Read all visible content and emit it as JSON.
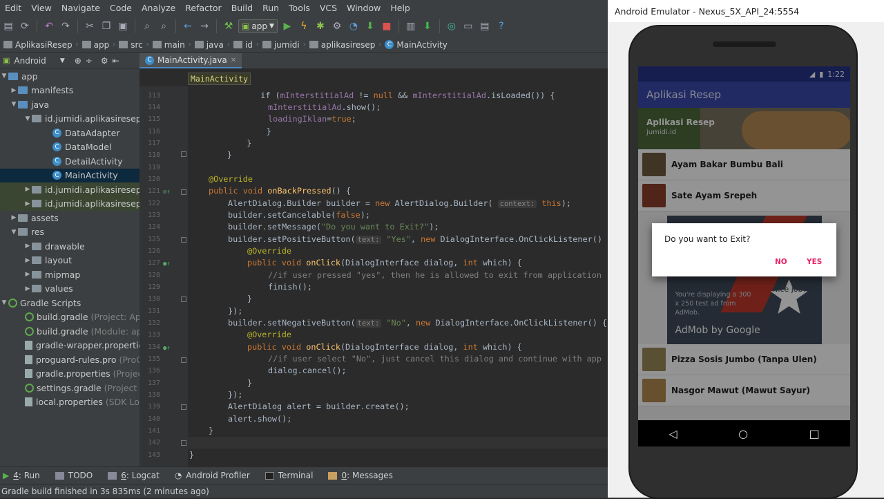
{
  "menu": [
    "Edit",
    "View",
    "Navigate",
    "Code",
    "Analyze",
    "Refactor",
    "Build",
    "Run",
    "Tools",
    "VCS",
    "Window",
    "Help"
  ],
  "toolbar": {
    "run_config": "app"
  },
  "breadcrumbs": [
    "AplikasiResep",
    "app",
    "src",
    "main",
    "java",
    "id",
    "jumidi",
    "aplikasiresep",
    "MainActivity"
  ],
  "project": {
    "view_mode": "Android",
    "tree": [
      {
        "label": "app",
        "hint": ""
      },
      {
        "label": "manifests",
        "hint": ""
      },
      {
        "label": "java",
        "hint": ""
      },
      {
        "label": "id.jumidi.aplikasiresep",
        "hint": ""
      },
      {
        "label": "DataAdapter",
        "hint": ""
      },
      {
        "label": "DataModel",
        "hint": ""
      },
      {
        "label": "DetailActivity",
        "hint": ""
      },
      {
        "label": "MainActivity",
        "hint": ""
      },
      {
        "label": "id.jumidi.aplikasiresep",
        "hint": "("
      },
      {
        "label": "id.jumidi.aplikasiresep",
        "hint": "("
      },
      {
        "label": "assets",
        "hint": ""
      },
      {
        "label": "res",
        "hint": ""
      },
      {
        "label": "drawable",
        "hint": ""
      },
      {
        "label": "layout",
        "hint": ""
      },
      {
        "label": "mipmap",
        "hint": ""
      },
      {
        "label": "values",
        "hint": ""
      },
      {
        "label": "Gradle Scripts",
        "hint": ""
      },
      {
        "label": "build.gradle",
        "hint": "(Project: Aplika"
      },
      {
        "label": "build.gradle",
        "hint": "(Module: app)"
      },
      {
        "label": "gradle-wrapper.properties",
        "hint": "("
      },
      {
        "label": "proguard-rules.pro",
        "hint": "(ProGua"
      },
      {
        "label": "gradle.properties",
        "hint": "(Project Pr"
      },
      {
        "label": "settings.gradle",
        "hint": "(Project Sett"
      },
      {
        "label": "local.properties",
        "hint": "(SDK Locati"
      }
    ]
  },
  "editor": {
    "tab": "MainActivity.java",
    "breadcrumb_chip": "MainActivity",
    "line_numbers": [
      "113",
      "114",
      "115",
      "116",
      "117",
      "118",
      "119",
      "120",
      "121",
      "122",
      "123",
      "124",
      "125",
      "126",
      "127",
      "128",
      "129",
      "130",
      "131",
      "132",
      "133",
      "134",
      "135",
      "136",
      "137",
      "138",
      "139",
      "140",
      "141",
      "142",
      "143"
    ],
    "code": {
      "l113_a": "            if (",
      "l113_b": "mInterstitialAd",
      "l113_c": " != ",
      "l113_d": "null",
      "l113_e": " && ",
      "l113_f": "mInterstitialAd",
      ".l113_g": "",
      "l113_g": ".isLoaded()) {",
      "l114_a": "mInterstitialAd",
      "l114_b": ".show();",
      "l115_a": "loadingIklan",
      "l115_b": "=",
      "l115_c": "true",
      ";": ";",
      "l116": "                }",
      "l117": "            }",
      "l118": "        }",
      "l120": "@Override",
      "l121_a": "public void ",
      "l121_b": "onBackPressed",
      "l121_c": "() {",
      "l122_a": "AlertDialog.Builder builder = ",
      "l122_b": "new ",
      "l122_c": "AlertDialog.Builder(",
      "l122_h": "context:",
      "l122_d": "this",
      ");": ");",
      "l123_a": "builder.setCancelable(",
      "l123_b": "false",
      "l124_a": "builder.setMessage(",
      "l124_b": "\"Do you want to Exit?\"",
      "l124_c": ");",
      "l125_a": "builder.setPositiveButton(",
      "l125_h": "text:",
      "l125_b": "\"Yes\"",
      "l125_c": ", ",
      "l125_d": "new ",
      "l125_e": "DialogInterface.OnClickListener() {",
      "l126": "@Override",
      "l127_a": "public void ",
      "l127_b": "onClick",
      "l127_c": "(DialogInterface dialog, ",
      "l127_d": "int ",
      "l127_e": "which) {",
      "l128": "//if user pressed \"yes\", then he is allowed to exit from application",
      "l129": "finish();",
      "l130": "}",
      "l131": "});",
      "l132_a": "builder.setNegativeButton(",
      "l132_h": "text:",
      "l132_b": "\"No\"",
      "l132_c": ", ",
      "l132_d": "new ",
      "l132_e": "DialogInterface.OnClickListener() {",
      "l133": "@Override",
      "l134_a": "public void ",
      "l134_b": "onClick",
      "l134_c": "(DialogInterface dialog, ",
      "l134_d": "int ",
      "l134_e": "which) {",
      "l135": "//if user select \"No\", just cancel this dialog and continue with app",
      "l136": "dialog.cancel();",
      "l137": "}",
      "l138": "});",
      "l139": "AlertDialog alert = builder.create();",
      "l140": "alert.show();",
      "l141": "}",
      "l143": "}"
    }
  },
  "bottom_tools": [
    {
      "num": "4",
      "label": ": Run"
    },
    {
      "num": "",
      "label": "TODO"
    },
    {
      "num": "6",
      "label": ": Logcat"
    },
    {
      "num": "",
      "label": "Android Profiler"
    },
    {
      "num": "",
      "label": "Terminal"
    },
    {
      "num": "0",
      "label": ": Messages"
    }
  ],
  "status_text": "Gradle build finished in 3s 835ms (2 minutes ago)",
  "emulator": {
    "title": "Android Emulator - Nexus_5X_API_24:5554",
    "time": "1:22",
    "app_title": "Aplikasi Resep",
    "banner_title": "Aplikasi Resep",
    "banner_sub": "jumidi.id",
    "items": [
      "Ayam Bakar Bumbu Bali",
      "Sate Ayam Srepeh",
      "Pizza Sosis Jumbo (Tanpa Ulen)",
      "Nasgor Mawut (Mawut Sayur)"
    ],
    "ad_text": "You're displaying a 300 x 250 test ad from AdMob.",
    "ad_badge": "Nice job!",
    "ad_brand": "AdMob by Google",
    "dialog_message": "Do you want to Exit?",
    "dialog_no": "NO",
    "dialog_yes": "YES"
  },
  "colors": {
    "accent_pink": "#e91e63",
    "primary": "#3949ab",
    "ide_bg": "#2b2b2b"
  }
}
